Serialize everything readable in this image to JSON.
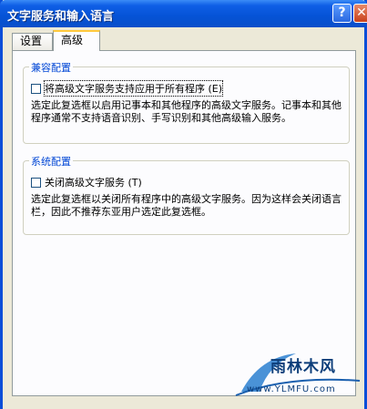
{
  "window": {
    "title": "文字服务和输入语言"
  },
  "titlebar": {
    "help_glyph": "?",
    "close_glyph": "✕"
  },
  "tabs": [
    {
      "label": "设置",
      "active": false
    },
    {
      "label": "高级",
      "active": true
    }
  ],
  "compat": {
    "title": "兼容配置",
    "checkbox_label": "将高级文字服务支持应用于所有程序 (E)",
    "checked": false,
    "description": "选定此复选框以启用记事本和其他程序的高级文字服务。记事本和其他程序通常不支持语音识别、手写识别和其他高级输入服务。"
  },
  "system": {
    "title": "系统配置",
    "checkbox_label": "关闭高级文字服务 (T)",
    "checked": false,
    "description": "选定此复选框以关闭所有程序中的高级文字服务。因为这样会关闭语言栏，因此不推荐东亚用户选定此复选框。"
  },
  "watermark": {
    "text": "雨林木风",
    "url": "www.YLMFU.com"
  }
}
